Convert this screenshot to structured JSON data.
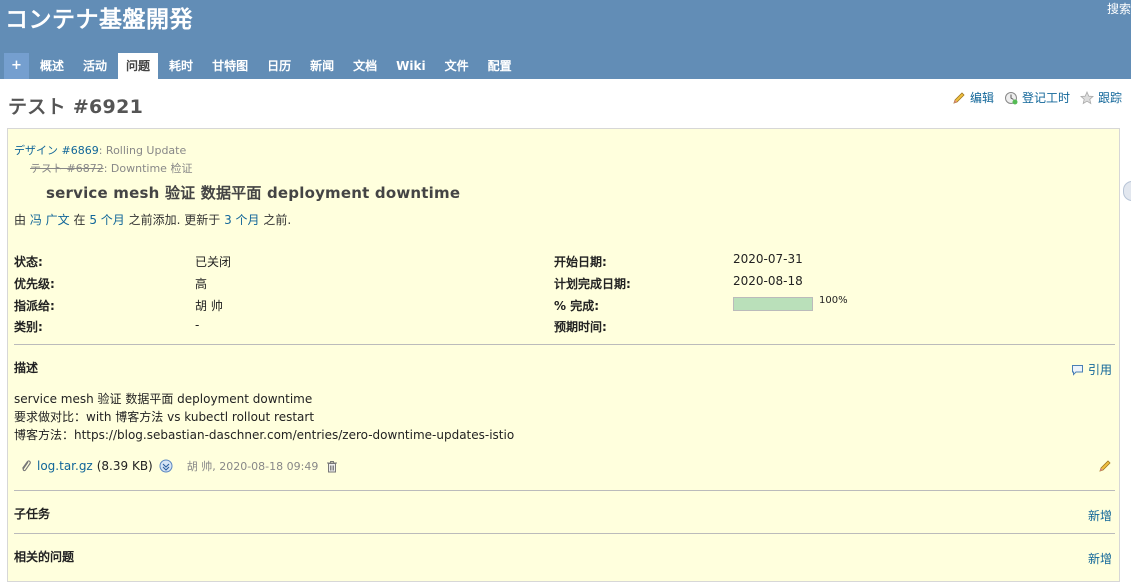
{
  "header": {
    "project_title": "コンテナ基盤開発",
    "search_label": "搜索",
    "new_label": "+",
    "tabs": [
      {
        "label": "概述"
      },
      {
        "label": "活动"
      },
      {
        "label": "问题",
        "selected": true
      },
      {
        "label": "耗时"
      },
      {
        "label": "甘特图"
      },
      {
        "label": "日历"
      },
      {
        "label": "新闻"
      },
      {
        "label": "文档"
      },
      {
        "label": "Wiki"
      },
      {
        "label": "文件"
      },
      {
        "label": "配置"
      }
    ]
  },
  "issue": {
    "title": "テスト #6921",
    "actions": {
      "edit": "编辑",
      "log_time": "登记工时",
      "watch": "跟踪"
    },
    "parents": {
      "grandparent_link": "デザイン #6869",
      "grandparent_subject": ": Rolling Update",
      "parent_link": "テスト #6872",
      "parent_subject": ": Downtime 检证"
    },
    "subject": "service mesh 验证 数据平面 deployment downtime",
    "author_line": {
      "by": "由",
      "author": "冯 广文",
      "at": "在",
      "created_ago": "5 个月",
      "added": "之前添加. 更新于",
      "updated_ago": "3 个月",
      "tail": "之前."
    },
    "attributes": {
      "status_label": "状态:",
      "status": "已关闭",
      "priority_label": "优先级:",
      "priority": "高",
      "assignee_label": "指派给:",
      "assignee": "胡 帅",
      "category_label": "类别:",
      "category": "-",
      "start_label": "开始日期:",
      "start_date": "2020-07-31",
      "due_label": "计划完成日期:",
      "due_date": "2020-08-18",
      "done_label": "% 完成:",
      "done_text": "100%",
      "done_fraction": 1.0,
      "estimated_label": "预期时间:"
    },
    "description": {
      "title": "描述",
      "quote_label": "引用",
      "lines": [
        "service mesh 验证 数据平面 deployment downtime",
        "要求做对比：with 博客方法 vs kubectl rollout restart",
        "博客方法：https://blog.sebastian-daschner.com/entries/zero-downtime-updates-istio"
      ]
    },
    "attachment": {
      "filename": "log.tar.gz",
      "size": "(8.39 KB)",
      "meta": "胡 帅, 2020-08-18 09:49"
    },
    "subtasks": {
      "title": "子任务",
      "new_label": "新增"
    },
    "relations": {
      "title": "相关的问题",
      "new_label": "新增"
    }
  },
  "colors": {
    "header_bg": "#628db6",
    "issue_bg": "#ffffdd",
    "link": "#116699",
    "progress_done": "#bae0ba"
  }
}
